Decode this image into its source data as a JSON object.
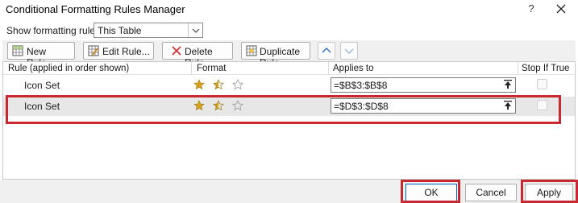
{
  "window": {
    "title": "Conditional Formatting Rules Manager",
    "help_glyph": "?"
  },
  "filter": {
    "label": "Show formatting rules for:",
    "value": "This Table"
  },
  "toolbar": {
    "new_rule": "New Rule...",
    "edit_rule": "Edit Rule...",
    "delete_rule": "Delete Rule",
    "duplicate_rule": "Duplicate Rule"
  },
  "grid": {
    "columns": {
      "rule": "Rule (applied in order shown)",
      "format": "Format",
      "applies_to": "Applies to",
      "stop_if_true": "Stop If True"
    },
    "rows": [
      {
        "rule": "Icon Set",
        "format_icons": [
          "star-full",
          "star-half",
          "star-empty"
        ],
        "applies_to": "=$B$3:$B$8",
        "stop_if_true": false,
        "selected": false
      },
      {
        "rule": "Icon Set",
        "format_icons": [
          "star-full",
          "star-half",
          "star-empty"
        ],
        "applies_to": "=$D$3:$D$8",
        "stop_if_true": false,
        "selected": true
      }
    ]
  },
  "footer": {
    "ok": "OK",
    "cancel": "Cancel",
    "apply": "Apply"
  },
  "colors": {
    "highlight": "#c8282f",
    "star_gold": "#d4a21c",
    "accent": "#0067c0"
  }
}
